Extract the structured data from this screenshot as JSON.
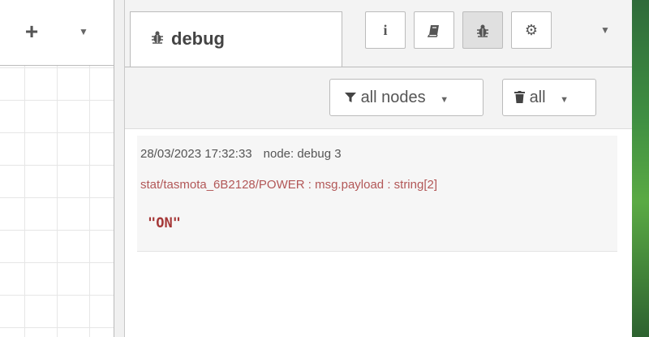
{
  "workspace": {
    "add_flow_icon": "plus-icon",
    "add_flow_label": "+",
    "menu_caret": "▼"
  },
  "sidebar": {
    "active_tab": {
      "icon": "bug-icon",
      "label": "debug"
    },
    "toolbar_buttons": [
      {
        "name": "info",
        "icon": "info-icon",
        "glyph": "i"
      },
      {
        "name": "help",
        "icon": "book-icon",
        "glyph": "▰"
      },
      {
        "name": "debug",
        "icon": "bug-icon",
        "glyph": "🐞",
        "selected": true
      },
      {
        "name": "config",
        "icon": "gear-icon",
        "glyph": "⚙"
      }
    ],
    "menu_caret": "▼"
  },
  "filter": {
    "nodes_label": "all nodes",
    "clear_label": "all",
    "caret": "▼"
  },
  "messages": [
    {
      "timestamp": "28/03/2023 17:32:33",
      "node": "node: debug 3",
      "topic": "stat/tasmota_6B2128/POWER : msg.payload : string[2]",
      "payload": "\"ON\""
    }
  ],
  "colors": {
    "topic": "#b25757",
    "payload": "#a53838",
    "selected_button": "#e0e0e0"
  }
}
